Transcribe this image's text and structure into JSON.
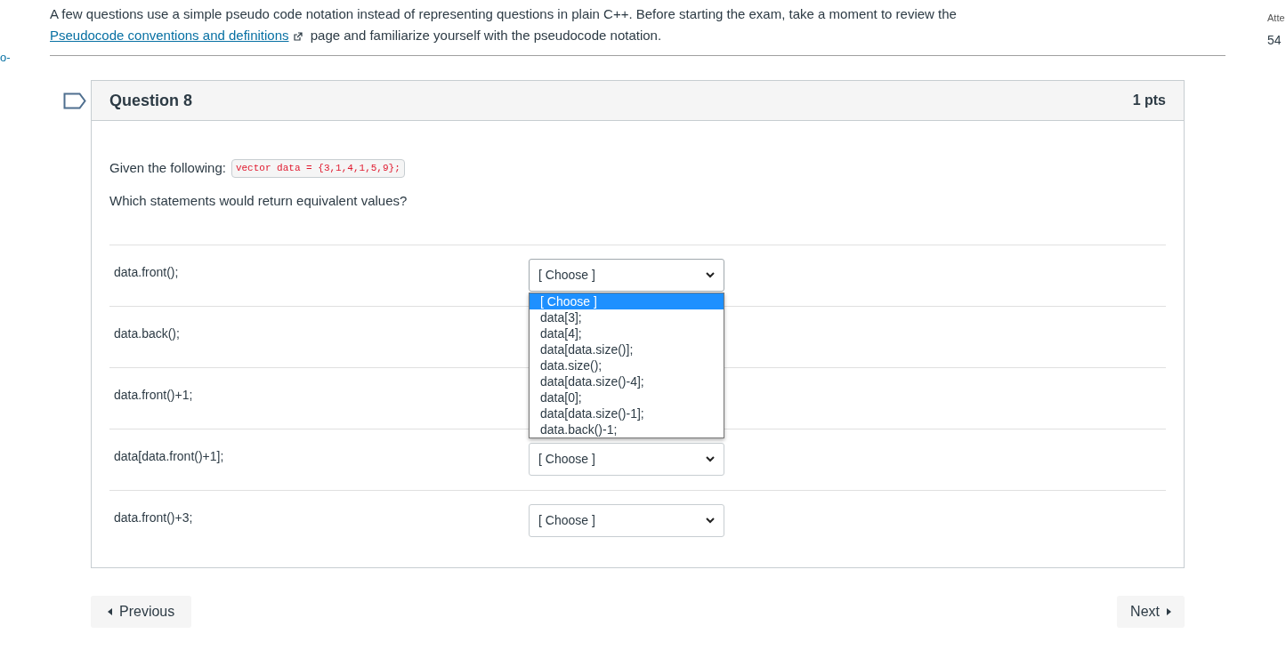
{
  "left_edge": {
    "text": "o-"
  },
  "right_edge": {
    "label": "Atte",
    "value": "54"
  },
  "intro": {
    "before": "A few questions use a simple pseudo code notation instead of representing questions in plain C++. Before starting the exam, take a moment to review the ",
    "link": "Pseudocode conventions and definitions",
    "after": " page and familiarize yourself with the pseudocode notation."
  },
  "question": {
    "title": "Question 8",
    "points": "1 pts",
    "prompt": "Given the following:",
    "code": "vector data = {3,1,4,1,5,9};",
    "instruction": "Which statements would return equivalent values?",
    "rows": [
      {
        "statement": "data.front();",
        "answer": "[ Choose ]",
        "open": true,
        "options": [
          {
            "label": "[ Choose ]",
            "selected": true
          },
          {
            "label": "data[3];",
            "selected": false
          },
          {
            "label": "data[4];",
            "selected": false
          },
          {
            "label": "data[data.size()];",
            "selected": false
          },
          {
            "label": "data.size();",
            "selected": false
          },
          {
            "label": "data[data.size()-4];",
            "selected": false
          },
          {
            "label": "data[0];",
            "selected": false
          },
          {
            "label": "data[data.size()-1];",
            "selected": false
          },
          {
            "label": "data.back()-1;",
            "selected": false
          }
        ]
      },
      {
        "statement": "data.back();"
      },
      {
        "statement": "data.front()+1;"
      },
      {
        "statement": "data[data.front()+1];",
        "answer": "[ Choose ]"
      },
      {
        "statement": "data.front()+3;",
        "answer": "[ Choose ]"
      }
    ]
  },
  "nav": {
    "previous": "Previous",
    "next": "Next"
  }
}
